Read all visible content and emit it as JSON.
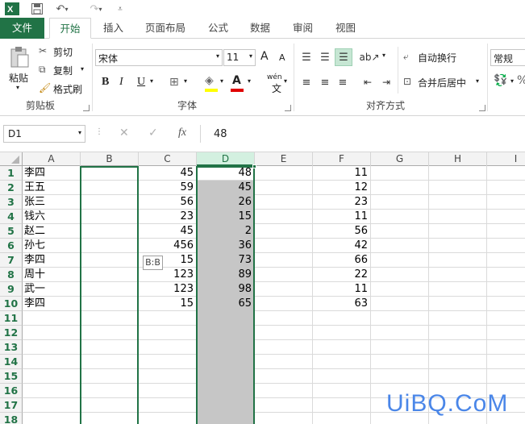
{
  "tabs": [
    "文件",
    "开始",
    "插入",
    "页面布局",
    "公式",
    "数据",
    "审阅",
    "视图"
  ],
  "clipboard": {
    "paste": "粘贴",
    "cut": "剪切",
    "copy": "复制",
    "format_painter": "格式刷",
    "group": "剪贴板"
  },
  "font": {
    "name": "宋体",
    "size": "11",
    "bold": "B",
    "italic": "I",
    "underline": "U",
    "grow": "A",
    "shrink": "A",
    "font_color": "A",
    "phonetic": "wén",
    "group": "字体"
  },
  "alignment": {
    "wrap": "自动换行",
    "merge": "合并后居中",
    "group": "对齐方式"
  },
  "number": {
    "format": "常规"
  },
  "formula_bar": {
    "name_box": "D1",
    "fx": "fx",
    "value": "48"
  },
  "columns": [
    "A",
    "B",
    "C",
    "D",
    "E",
    "F",
    "G",
    "H",
    "I"
  ],
  "rows": [
    "1",
    "2",
    "3",
    "4",
    "5",
    "6",
    "7",
    "8",
    "9",
    "10",
    "11",
    "12",
    "13",
    "14",
    "15",
    "16",
    "17",
    "18"
  ],
  "col_a": [
    "李四",
    "王五",
    "张三",
    "钱六",
    "赵二",
    "孙七",
    "李四",
    "周十",
    "武一",
    "李四"
  ],
  "col_c": [
    "45",
    "59",
    "56",
    "23",
    "45",
    "456",
    "15",
    "123",
    "123",
    "15"
  ],
  "col_d": [
    "48",
    "45",
    "26",
    "15",
    "2",
    "36",
    "73",
    "89",
    "98",
    "65"
  ],
  "col_f": [
    "11",
    "12",
    "23",
    "11",
    "56",
    "42",
    "66",
    "22",
    "11",
    "63"
  ],
  "tooltip": "B:B",
  "watermark": "UiBQ.CoM",
  "colors": {
    "accent": "#217346",
    "selection": "#c6c6c6"
  }
}
